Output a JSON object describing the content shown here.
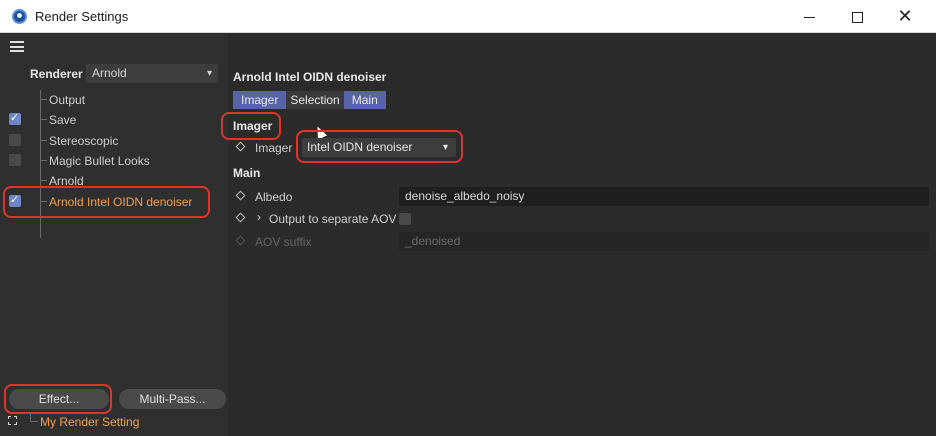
{
  "window": {
    "title": "Render Settings",
    "minimize": "—",
    "maximize": "☐",
    "close": "✕"
  },
  "left": {
    "renderer_label": "Renderer",
    "renderer_value": "Arnold",
    "tree": [
      {
        "label": "Output",
        "checkbox": false,
        "checked": false,
        "active": false
      },
      {
        "label": "Save",
        "checkbox": true,
        "checked": true,
        "active": false
      },
      {
        "label": "Stereoscopic",
        "checkbox": true,
        "checked": false,
        "active": false
      },
      {
        "label": "Magic Bullet Looks",
        "checkbox": true,
        "checked": false,
        "active": false
      },
      {
        "label": "Arnold",
        "checkbox": false,
        "checked": false,
        "active": false
      },
      {
        "label": "Arnold Intel OIDN denoiser",
        "checkbox": true,
        "checked": true,
        "active": true
      }
    ],
    "effect_button": "Effect...",
    "multipass_button": "Multi-Pass...",
    "render_setting": "My Render Setting"
  },
  "right": {
    "object_title": "Arnold Intel OIDN denoiser",
    "tabs": [
      {
        "label": "Imager",
        "active": true
      },
      {
        "label": "Selection",
        "active": false
      },
      {
        "label": "Main",
        "active": true
      }
    ],
    "imager_section": "Imager",
    "imager_label": "Imager",
    "imager_value": "Intel OIDN denoiser",
    "main_section": "Main",
    "albedo_label": "Albedo",
    "albedo_value": "denoise_albedo_noisy",
    "output_aov_label": "Output to separate AOV",
    "aov_suffix_label": "AOV suffix",
    "aov_suffix_value": "_denoised"
  },
  "colors": {
    "accent_tab": "#5765a8",
    "highlight_text": "#f0a04b",
    "annotation_red": "#e0342b"
  }
}
